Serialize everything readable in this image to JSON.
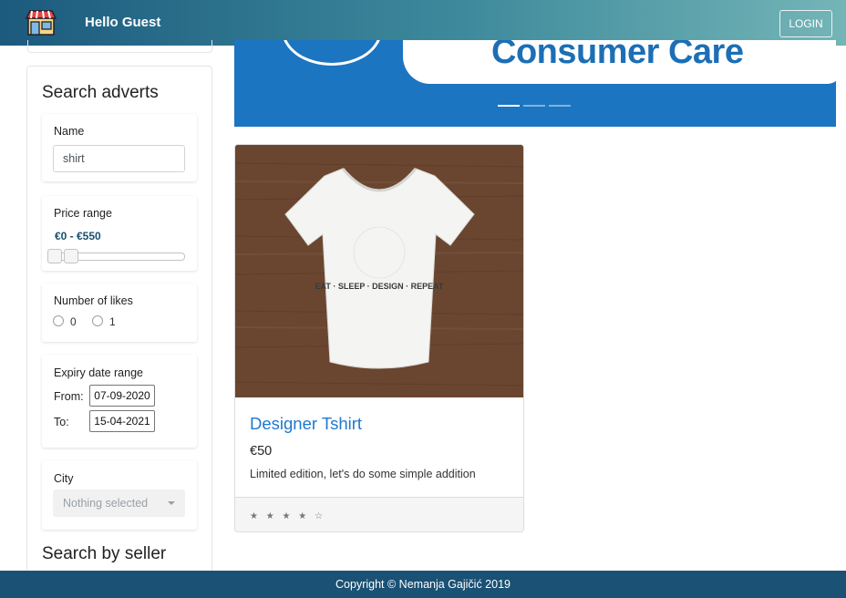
{
  "navbar": {
    "greeting": "Hello Guest",
    "login_label": "LOGIN",
    "logo_icon": "storefront-icon"
  },
  "sidebar": {
    "title": "Search adverts",
    "name_filter": {
      "label": "Name",
      "value": "shirt"
    },
    "price_filter": {
      "label": "Price range",
      "value_text": "€0 - €550",
      "min": 0,
      "max": 550
    },
    "likes_filter": {
      "label": "Number of likes",
      "options": [
        "0",
        "1"
      ]
    },
    "expiry_filter": {
      "label": "Expiry date range",
      "from_label": "From:",
      "from_value": "07-09-2020",
      "to_label": "To:",
      "to_value": "15-04-2021"
    },
    "city_filter": {
      "label": "City",
      "placeholder": "Nothing selected"
    },
    "seller_title": "Search by seller"
  },
  "banner": {
    "text": "Consumer Care",
    "slide_count": 3,
    "active_slide": 1
  },
  "products": [
    {
      "title": "Designer Tshirt",
      "price": "€50",
      "description": "Limited edition, let's do some simple addition",
      "rating_stars": "★ ★ ★ ★ ☆",
      "image_text": "EAT · SLEEP · DESIGN · REPEAT"
    }
  ],
  "footer": {
    "copyright": "Copyright © Nemanja Gajičić 2019"
  },
  "colors": {
    "navbar_start": "#1c5a7e",
    "navbar_end": "#74b5b7",
    "banner": "#1c75c0",
    "link": "#1f78d1",
    "footer": "#1a5174"
  }
}
